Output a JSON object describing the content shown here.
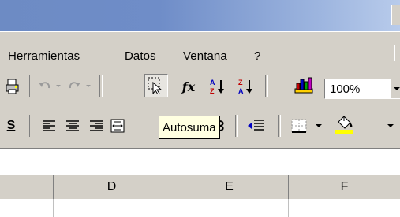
{
  "menu": {
    "herramientas": {
      "accel": "H",
      "rest": "erramientas"
    },
    "datos": {
      "pre": "Da",
      "accel": "t",
      "rest": "os"
    },
    "ventana": {
      "pre": "Ve",
      "accel": "n",
      "rest": "tana"
    },
    "help": {
      "accel": "?"
    }
  },
  "toolbar": {
    "zoom_value": "100%",
    "function_label": "fx",
    "tooltip": "Autosuma",
    "bold_partial": "S"
  },
  "columns": [
    "D",
    "E",
    "F"
  ],
  "colors": {
    "title_gradient_start": "#6d8bc4",
    "title_gradient_end": "#b8cbeb",
    "chrome": "#d4d0c8",
    "tooltip_bg": "#ffffe1",
    "fill_color_bar": "#ffff00"
  },
  "icons": [
    "print-icon",
    "undo-icon",
    "redo-icon",
    "cursor-select-icon",
    "function-icon",
    "sort-ascending-icon",
    "sort-descending-icon",
    "chart-wizard-icon",
    "align-left-icon",
    "align-center-icon",
    "align-right-icon",
    "merge-center-icon",
    "decrease-indent-icon",
    "borders-icon",
    "fill-color-icon"
  ]
}
